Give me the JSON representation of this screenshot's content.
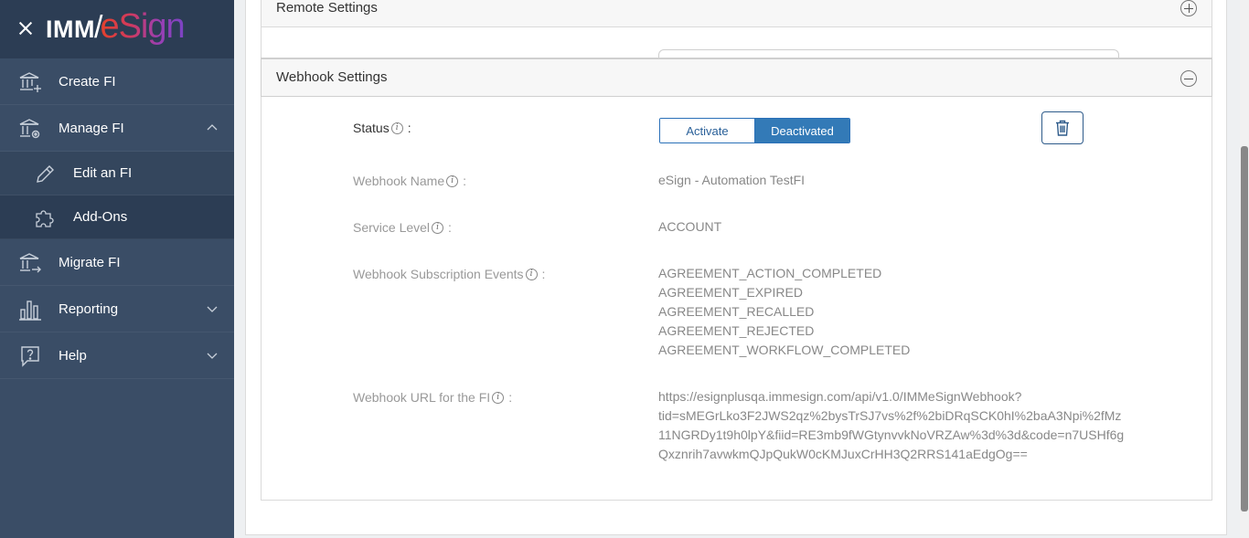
{
  "brand": {
    "logo_part1": "IMM",
    "logo_slash": "/",
    "logo_part2": "eSign"
  },
  "sidebar": {
    "items": [
      {
        "label": "Create FI",
        "icon": "bank-add-icon"
      },
      {
        "label": "Manage FI",
        "icon": "bank-settings-icon",
        "expanded": true
      },
      {
        "label": "Edit an FI",
        "icon": "pencil-icon",
        "sub": true,
        "active": true
      },
      {
        "label": "Add-Ons",
        "icon": "puzzle-icon",
        "sub": true
      },
      {
        "label": "Migrate FI",
        "icon": "bank-migrate-icon"
      },
      {
        "label": "Reporting",
        "icon": "bar-chart-icon",
        "expanded": false
      },
      {
        "label": "Help",
        "icon": "help-bubble-icon",
        "expanded": false
      }
    ]
  },
  "panels": {
    "remote": {
      "title": "Remote Settings"
    },
    "webhook": {
      "title": "Webhook Settings"
    }
  },
  "webhook": {
    "status_label": "Status",
    "status_options": [
      "Activate",
      "Deactivated"
    ],
    "status_selected": "Deactivated",
    "name_label": "Webhook Name",
    "name_value": "eSign - Automation TestFI",
    "service_label": "Service Level",
    "service_value": "ACCOUNT",
    "events_label": "Webhook Subscription Events",
    "events": [
      "AGREEMENT_ACTION_COMPLETED",
      "AGREEMENT_EXPIRED",
      "AGREEMENT_RECALLED",
      "AGREEMENT_REJECTED",
      "AGREEMENT_WORKFLOW_COMPLETED"
    ],
    "url_label": "Webhook URL for the FI",
    "url_lines": [
      "https://esignplusqa.immesign.com/api/v1.0/IMMeSignWebhook?",
      "tid=sMEGrLko3F2JWS2qz%2bysTrSJ7vs%2f%2biDRqSCK0hI%2baA3Npi%2fMz",
      "11NGRDy1t9h0lpY&fiid=RE3mb9fWGtynvvkNoVRZAw%3d%3d&code=n7USHf6g",
      "Qxznrih7avwkmQJpQukW0cKMJuxCrHH3Q2RRS141aEdgOg=="
    ],
    "colon": ":"
  },
  "colors": {
    "sidebar_bg": "#3a4d66",
    "sidebar_header_bg": "#2c3d54",
    "accent_blue": "#337ab7"
  }
}
